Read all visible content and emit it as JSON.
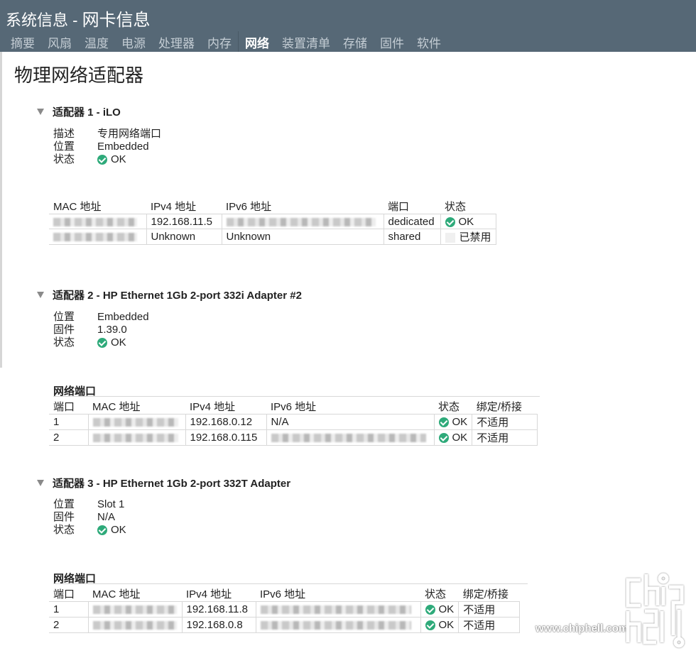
{
  "header": {
    "title_prefix": "系统信息 - ",
    "title_main": "网卡信息",
    "tabs": [
      {
        "label": "摘要",
        "active": false
      },
      {
        "label": "风扇",
        "active": false
      },
      {
        "label": "温度",
        "active": false
      },
      {
        "label": "电源",
        "active": false
      },
      {
        "label": "处理器",
        "active": false
      },
      {
        "label": "内存",
        "active": false
      },
      {
        "label": "网络",
        "active": true
      },
      {
        "label": "装置清单",
        "active": false
      },
      {
        "label": "存储",
        "active": false
      },
      {
        "label": "固件",
        "active": false
      },
      {
        "label": "软件",
        "active": false
      }
    ]
  },
  "page_title": "物理网络适配器",
  "adapters": [
    {
      "title": "适配器 1 - iLO",
      "props": [
        {
          "key": "描述",
          "value": "专用网络端口"
        },
        {
          "key": "位置",
          "value": "Embedded"
        },
        {
          "key": "状态",
          "value": "OK",
          "icon": "check-circle-icon"
        }
      ],
      "table": {
        "headers": [
          "MAC 地址",
          "IPv4 地址",
          "IPv6 地址",
          "端口",
          "状态"
        ],
        "rows": [
          {
            "mac": "[redacted]",
            "ipv4": "192.168.11.5",
            "ipv6": "[redacted]",
            "port": "dedicated",
            "status": "OK",
            "status_icon": "check-circle-icon"
          },
          {
            "mac": "[redacted]",
            "ipv4": "Unknown",
            "ipv6": "Unknown",
            "port": "shared",
            "status": "已禁用",
            "status_icon": "disabled-icon"
          }
        ]
      }
    },
    {
      "title": "适配器 2 - HP Ethernet 1Gb 2-port 332i Adapter #2",
      "props": [
        {
          "key": "位置",
          "value": "Embedded"
        },
        {
          "key": "固件",
          "value": "1.39.0"
        },
        {
          "key": "状态",
          "value": "OK",
          "icon": "check-circle-icon"
        }
      ],
      "ports_title": "网络端口",
      "table": {
        "headers": [
          "端口",
          "MAC 地址",
          "IPv4 地址",
          "IPv6 地址",
          "状态",
          "绑定/桥接"
        ],
        "rows": [
          {
            "port": "1",
            "mac": "[redacted]",
            "ipv4": "192.168.0.12",
            "ipv6": "N/A",
            "status": "OK",
            "bond": "不适用"
          },
          {
            "port": "2",
            "mac": "[redacted]",
            "ipv4": "192.168.0.115",
            "ipv6": "[redacted]",
            "status": "OK",
            "bond": "不适用"
          }
        ]
      }
    },
    {
      "title": "适配器 3 - HP Ethernet 1Gb 2-port 332T Adapter",
      "props": [
        {
          "key": "位置",
          "value": "Slot 1"
        },
        {
          "key": "固件",
          "value": "N/A"
        },
        {
          "key": "状态",
          "value": "OK",
          "icon": "check-circle-icon"
        }
      ],
      "ports_title": "网络端口",
      "table": {
        "headers": [
          "端口",
          "MAC 地址",
          "IPv4 地址",
          "IPv6 地址",
          "状态",
          "绑定/桥接"
        ],
        "rows": [
          {
            "port": "1",
            "mac": "[redacted]",
            "ipv4": "192.168.11.8",
            "ipv6": "[redacted]",
            "status": "OK",
            "bond": "不适用"
          },
          {
            "port": "2",
            "mac": "[redacted]",
            "ipv4": "192.168.0.8",
            "ipv6": "[redacted]",
            "status": "OK",
            "bond": "不适用"
          }
        ]
      }
    }
  ],
  "watermark": {
    "text": "www.chiphell.com",
    "logo": "chip hell"
  },
  "colors": {
    "header_bg": "#566876",
    "ok_green": "#2eaa7a",
    "tab_inactive": "#c4cdd4"
  }
}
